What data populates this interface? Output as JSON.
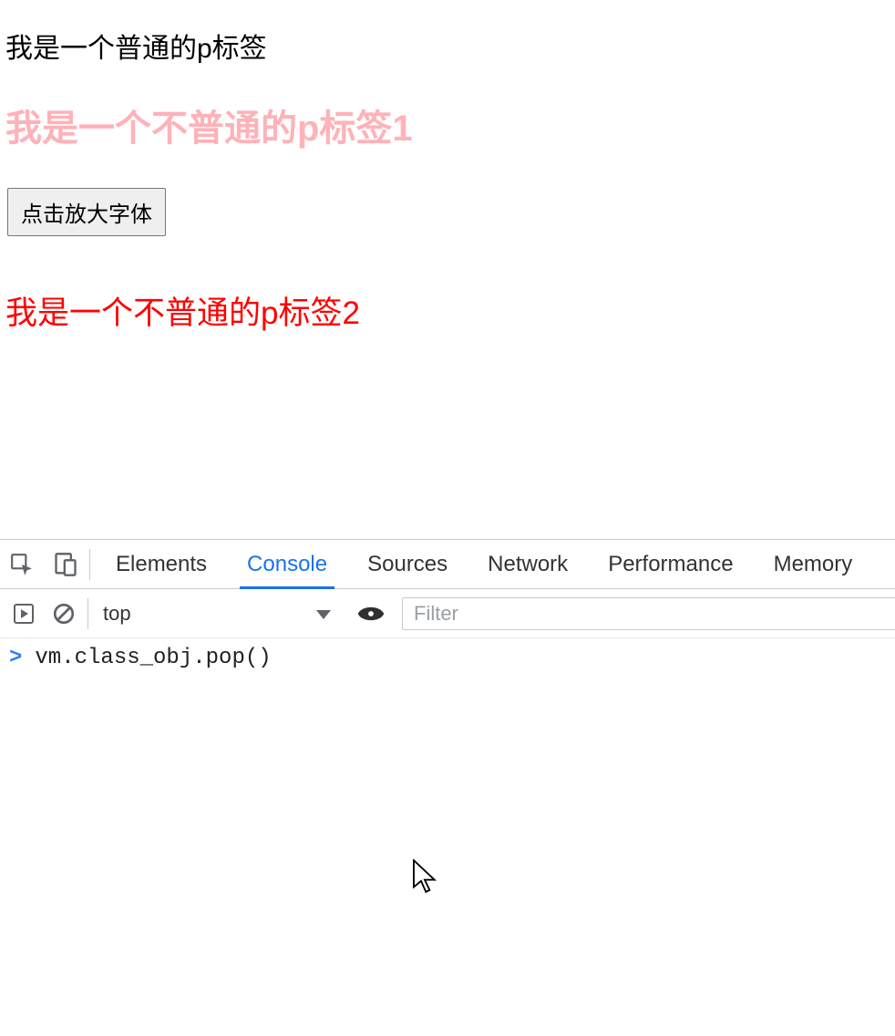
{
  "page": {
    "p_normal": "我是一个普通的p标签",
    "p_special1": "我是一个不普通的p标签1",
    "button_label": "点击放大字体",
    "p_special2": "我是一个不普通的p标签2"
  },
  "devtools": {
    "tabs": {
      "elements": "Elements",
      "console": "Console",
      "sources": "Sources",
      "network": "Network",
      "performance": "Performance",
      "memory": "Memory"
    },
    "active_tab": "Console",
    "toolbar": {
      "context_value": "top",
      "filter_placeholder": "Filter"
    },
    "console": {
      "prompt": ">",
      "input_text": "vm.class_obj.pop()"
    }
  }
}
